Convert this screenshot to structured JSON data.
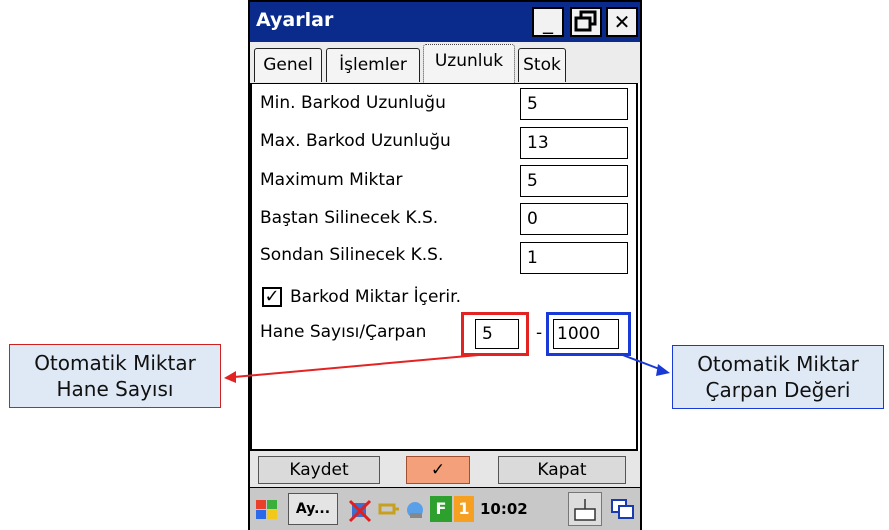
{
  "window": {
    "title": "Ayarlar",
    "buttons": {
      "minimize": "_",
      "restore": "🗗",
      "close": "✕"
    }
  },
  "tabs": [
    {
      "label": "Genel",
      "active": false
    },
    {
      "label": "İşlemler",
      "active": false
    },
    {
      "label": "Uzunluk",
      "active": true
    },
    {
      "label": "Stok",
      "active": false
    }
  ],
  "fields": [
    {
      "label": "Min. Barkod Uzunluğu",
      "value": "5"
    },
    {
      "label": "Max. Barkod Uzunluğu",
      "value": "13"
    },
    {
      "label": "Maximum Miktar",
      "value": "5"
    },
    {
      "label": "Baştan Silinecek K.S.",
      "value": "0"
    },
    {
      "label": "Sondan Silinecek K.S.",
      "value": "1"
    }
  ],
  "checkbox": {
    "label": "Barkod Miktar İçerir.",
    "checked": true,
    "mark": "✓"
  },
  "hane": {
    "label": "Hane Sayısı/Çarpan",
    "count": "5",
    "separator": "-",
    "multiplier": "1000"
  },
  "buttons": {
    "save": "Kaydet",
    "ok": "✓",
    "close": "Kapat"
  },
  "taskbar": {
    "app": "Ay...",
    "time": "10:02",
    "f_label": "F",
    "one_label": "1"
  },
  "callouts": {
    "left": {
      "line1": "Otomatik Miktar",
      "line2": "Hane Sayısı"
    },
    "right": {
      "line1": "Otomatik Miktar",
      "line2": "Çarpan Değeri"
    }
  },
  "colors": {
    "titlebar": "#0a2a8c",
    "highlight_red": "#e32222",
    "highlight_blue": "#1a3ad8",
    "callout_bg": "#dfe9f6"
  }
}
